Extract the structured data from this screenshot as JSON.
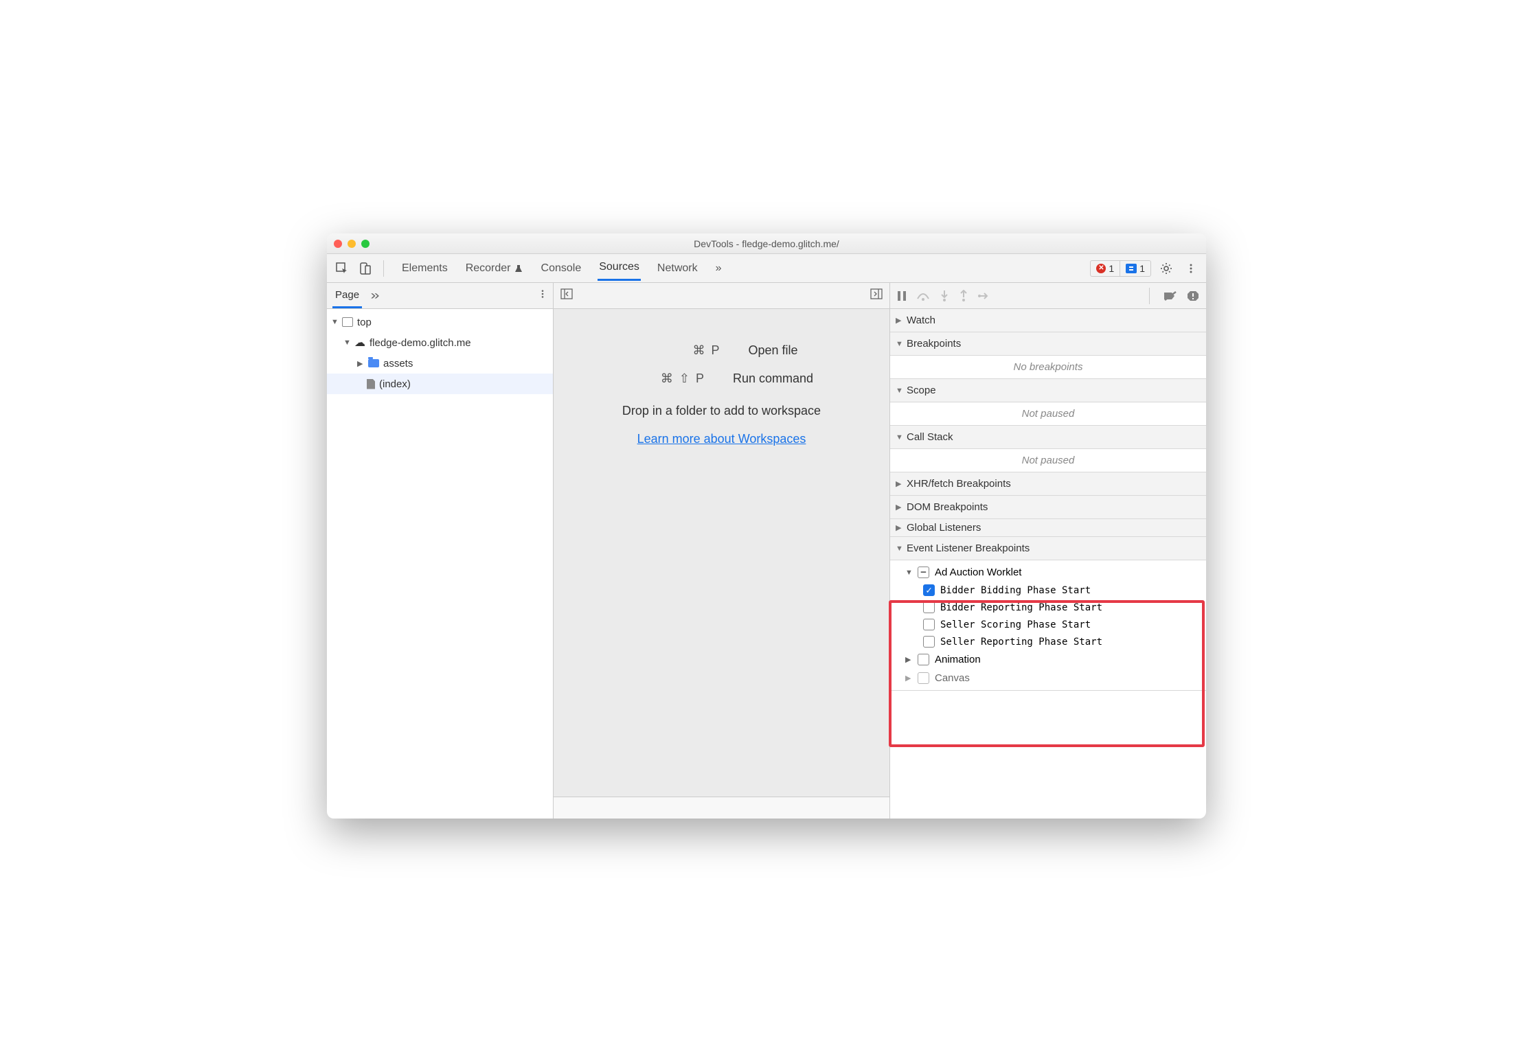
{
  "window": {
    "title": "DevTools - fledge-demo.glitch.me/"
  },
  "toolbar": {
    "tabs": [
      "Elements",
      "Recorder",
      "Console",
      "Sources",
      "Network"
    ],
    "active": "Sources",
    "more_indicator": "»",
    "error_count": "1",
    "message_count": "1"
  },
  "page_pane": {
    "tab": "Page",
    "more": "»",
    "tree": {
      "top": "top",
      "domain": "fledge-demo.glitch.me",
      "folder": "assets",
      "file": "(index)"
    }
  },
  "center": {
    "open_file_keys": "⌘ P",
    "open_file_label": "Open file",
    "run_cmd_keys": "⌘ ⇧ P",
    "run_cmd_label": "Run command",
    "drop_hint": "Drop in a folder to add to workspace",
    "learn_more": "Learn more about Workspaces"
  },
  "debugger": {
    "sections": {
      "watch": "Watch",
      "breakpoints": "Breakpoints",
      "breakpoints_empty": "No breakpoints",
      "scope": "Scope",
      "scope_empty": "Not paused",
      "callstack": "Call Stack",
      "callstack_empty": "Not paused",
      "xhr": "XHR/fetch Breakpoints",
      "dom": "DOM Breakpoints",
      "global": "Global Listeners",
      "event_listener": "Event Listener Breakpoints",
      "ad_auction": {
        "label": "Ad Auction Worklet",
        "items": [
          {
            "label": "Bidder Bidding Phase Start",
            "checked": true
          },
          {
            "label": "Bidder Reporting Phase Start",
            "checked": false
          },
          {
            "label": "Seller Scoring Phase Start",
            "checked": false
          },
          {
            "label": "Seller Reporting Phase Start",
            "checked": false
          }
        ]
      },
      "animation": "Animation",
      "canvas": "Canvas"
    }
  }
}
